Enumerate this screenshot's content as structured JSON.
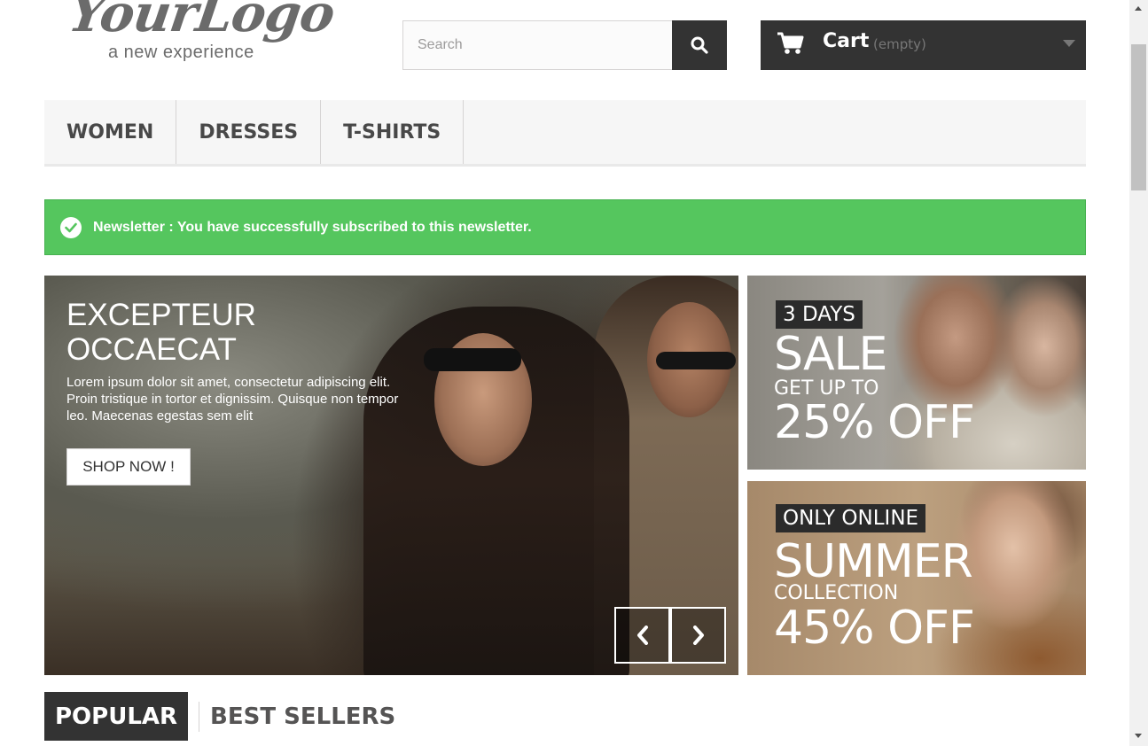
{
  "header": {
    "logo_main": "YourLogo",
    "logo_sub": "a new experience",
    "search": {
      "placeholder": "Search",
      "value": ""
    },
    "cart": {
      "label": "Cart",
      "status": "(empty)"
    }
  },
  "nav": {
    "items": [
      {
        "label": "WOMEN"
      },
      {
        "label": "DRESSES"
      },
      {
        "label": "T-SHIRTS"
      }
    ]
  },
  "alert": {
    "text": "Newsletter : You have successfully subscribed to this newsletter.",
    "color": "#55c65e"
  },
  "slider": {
    "title_line1": "EXCEPTEUR",
    "title_line2": "OCCAECAT",
    "text": "Lorem ipsum dolor sit amet, consectetur adipiscing elit. Proin tristique in tortor et dignissim. Quisque non tempor leo. Maecenas egestas sem elit",
    "button": "SHOP NOW !"
  },
  "promos": [
    {
      "tag": "3 DAYS",
      "headline": "SALE",
      "sub": "GET UP TO",
      "offer": "25% OFF"
    },
    {
      "tag": "ONLY ONLINE",
      "headline": "SUMMER",
      "sub": "COLLECTION",
      "offer": "45% OFF"
    }
  ],
  "tabs": {
    "active": "POPULAR",
    "other": "BEST SELLERS"
  },
  "colors": {
    "dark": "#333333",
    "success": "#55c65e",
    "nav_bg": "#f6f6f6"
  },
  "icons": {
    "search": "search-icon",
    "cart": "cart-icon",
    "check": "check-circle-icon",
    "prev": "chevron-left-icon",
    "next": "chevron-right-icon"
  }
}
